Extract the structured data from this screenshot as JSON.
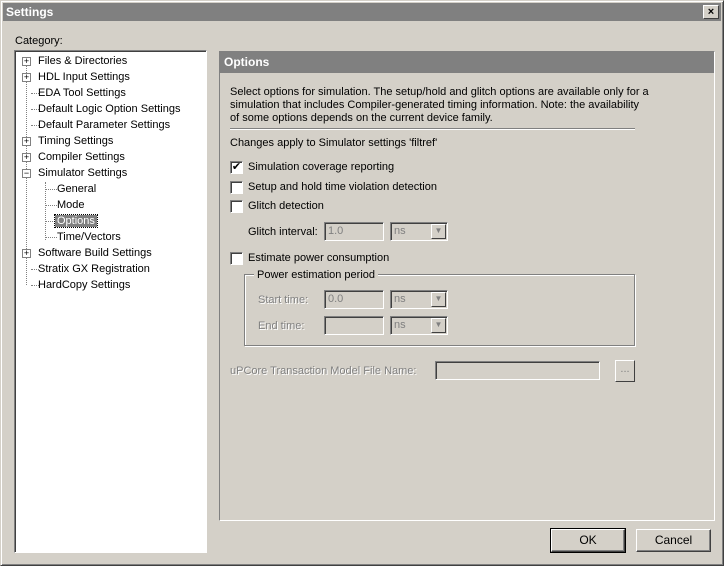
{
  "window": {
    "title": "Settings",
    "close_glyph": "×"
  },
  "category_label": "Category:",
  "tree": {
    "items": [
      {
        "label": "Files & Directories",
        "expander": "+"
      },
      {
        "label": "HDL Input Settings",
        "expander": "+"
      },
      {
        "label": "EDA Tool Settings",
        "expander": ""
      },
      {
        "label": "Default Logic Option Settings",
        "expander": ""
      },
      {
        "label": "Default Parameter Settings",
        "expander": ""
      },
      {
        "label": "Timing Settings",
        "expander": "+"
      },
      {
        "label": "Compiler Settings",
        "expander": "+"
      },
      {
        "label": "Simulator Settings",
        "expander": "−"
      },
      {
        "label": "General",
        "expander": ""
      },
      {
        "label": "Mode",
        "expander": ""
      },
      {
        "label": "Options",
        "expander": "",
        "selected": true
      },
      {
        "label": "Time/Vectors",
        "expander": ""
      },
      {
        "label": "Software Build Settings",
        "expander": "+"
      },
      {
        "label": "Stratix GX Registration",
        "expander": ""
      },
      {
        "label": "HardCopy Settings",
        "expander": ""
      }
    ]
  },
  "options": {
    "header": "Options",
    "description": "Select options for simulation.  The setup/hold and glitch options are available only for a simulation that includes Compiler-generated timing information.  Note: the availability of some options depends on the current device family.",
    "changes_text": "Changes apply to Simulator settings 'filtref'",
    "coverage": {
      "label": "Simulation coverage reporting",
      "checked": "✔"
    },
    "setup_hold": {
      "label": "Setup and hold time violation detection",
      "checked": ""
    },
    "glitch": {
      "label": "Glitch detection",
      "checked": ""
    },
    "glitch_interval": {
      "label": "Glitch interval:",
      "value": "1.0",
      "unit": "ns"
    },
    "power": {
      "label": "Estimate power consumption",
      "checked": ""
    },
    "power_period": {
      "legend": "Power estimation period",
      "start_label": "Start time:",
      "start_value": "0.0",
      "start_unit": "ns",
      "end_label": "End time:",
      "end_value": "",
      "end_unit": "ns"
    },
    "upcore": {
      "label": "uPCore Transaction Model File Name:",
      "value": "",
      "browse": "..."
    }
  },
  "buttons": {
    "ok": "OK",
    "cancel": "Cancel"
  },
  "icons": {
    "dropdown": "chevron-down-icon",
    "expand": "plus-icon",
    "collapse": "minus-icon",
    "check": "check-icon"
  }
}
